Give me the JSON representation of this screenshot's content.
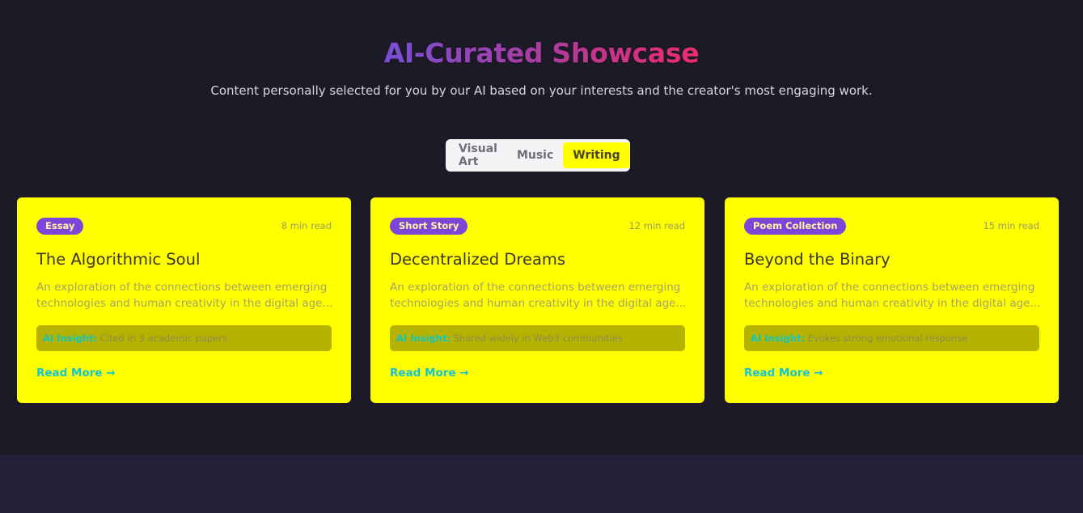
{
  "header": {
    "title": "AI-Curated Showcase",
    "subtitle": "Content personally selected for you by our AI based on your interests and the creator's most engaging work."
  },
  "tabs": [
    {
      "label": "Visual Art",
      "active": false
    },
    {
      "label": "Music",
      "active": false
    },
    {
      "label": "Writing",
      "active": true
    }
  ],
  "cards": [
    {
      "badge": "Essay",
      "read_time": "8 min read",
      "title": "The Algorithmic Soul",
      "description": "An exploration of the connections between emerging technologies and human creativity in the digital age...",
      "insight_label": "AI Insight:",
      "insight_text": "Cited in 3 academic papers",
      "read_more": "Read More →"
    },
    {
      "badge": "Short Story",
      "read_time": "12 min read",
      "title": "Decentralized Dreams",
      "description": "An exploration of the connections between emerging technologies and human creativity in the digital age...",
      "insight_label": "AI Insight:",
      "insight_text": "Shared widely in Web3 communities",
      "read_more": "Read More →"
    },
    {
      "badge": "Poem Collection",
      "read_time": "15 min read",
      "title": "Beyond the Binary",
      "description": "An exploration of the connections between emerging technologies and human creativity in the digital age...",
      "insight_label": "AI Insight:",
      "insight_text": "Evokes strong emotional response",
      "read_more": "Read More →"
    }
  ],
  "colors": {
    "background": "#1b1a26",
    "card": "#ffff00",
    "badge": "#7e46d8",
    "accent": "#12c6d6",
    "title_gradient_start": "#7a4fd6",
    "title_gradient_end": "#ee2b6c"
  }
}
